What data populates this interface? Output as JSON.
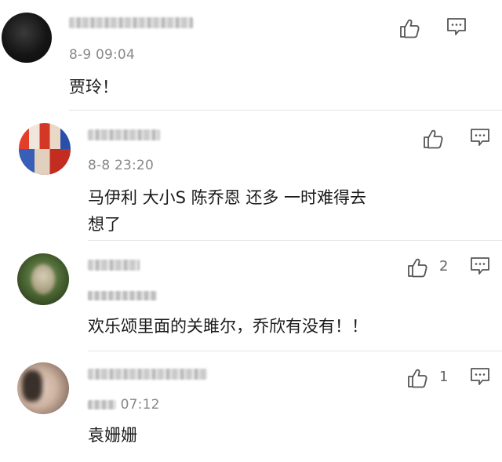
{
  "comments": [
    {
      "author": "",
      "time_visible": "8-9 09:04",
      "text": "贾玲！",
      "likes": ""
    },
    {
      "author": "",
      "time_visible": "8-8 23:20",
      "text_line1": "马伊利   大小S   陈乔恩   还多  一时难得去",
      "text_line2": "想了",
      "likes": ""
    },
    {
      "author": "",
      "time_visible": "",
      "text": "欢乐颂里面的关雎尔，乔欣有没有！！",
      "likes": "2"
    },
    {
      "author": "",
      "time_visible": "07:12",
      "text": "袁姗姗",
      "likes": "1"
    }
  ],
  "icons": {
    "like": "thumbs-up-icon",
    "reply": "comment-bubble-icon"
  },
  "colors": {
    "text": "#1a1a1a",
    "meta": "#888888",
    "icon": "#555555",
    "divider": "#e6e6e6"
  }
}
